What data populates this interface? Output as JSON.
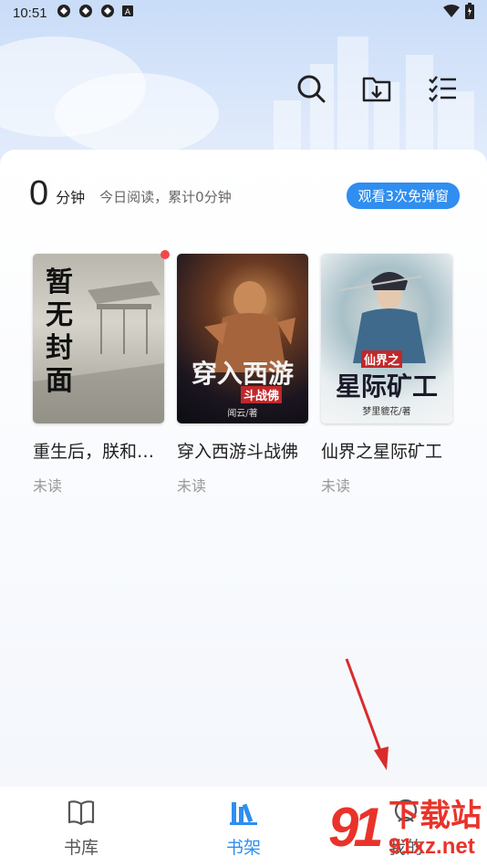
{
  "status_bar": {
    "time": "10:51",
    "notification_icons": [
      "sync-icon",
      "sync-icon",
      "sync-icon",
      "a-icon"
    ],
    "right_icons": [
      "wifi-icon",
      "battery-icon"
    ]
  },
  "header": {
    "actions": [
      "search-icon",
      "download-folder-icon",
      "list-icon"
    ]
  },
  "reading_stats": {
    "minutes": "0",
    "unit": "分钟",
    "description": "今日阅读，累计0分钟",
    "watch_button": "观看3次免弹窗"
  },
  "books": [
    {
      "title": "重生后，朕和…",
      "status": "未读",
      "cover_text": "暂无封面",
      "has_update_dot": true
    },
    {
      "title": "穿入西游斗战佛",
      "status": "未读",
      "cover_text": "穿入西游",
      "cover_subtext": "斗战佛",
      "cover_author": "闻云/著",
      "has_update_dot": false
    },
    {
      "title": "仙界之星际矿工",
      "status": "未读",
      "cover_text": "星际矿工",
      "cover_subtext": "仙界之",
      "cover_author": "梦里貔花/著",
      "has_update_dot": false
    }
  ],
  "tabbar": {
    "tabs": [
      {
        "label": "书库",
        "icon": "book-icon",
        "active": false
      },
      {
        "label": "书架",
        "icon": "bookshelf-icon",
        "active": true
      },
      {
        "label": "我的",
        "icon": "user-icon",
        "active": false
      }
    ]
  },
  "watermark": {
    "logo": "91",
    "name": "下载站",
    "url": "91xz.net"
  },
  "colors": {
    "accent": "#2f8ef0",
    "red_dot": "#f04848",
    "watermark_red": "#e9332a"
  }
}
